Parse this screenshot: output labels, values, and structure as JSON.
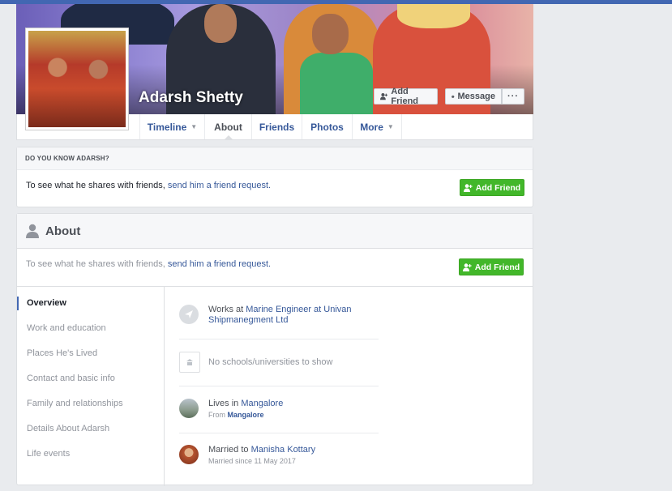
{
  "profile": {
    "name": "Adarsh Shetty"
  },
  "cover_buttons": {
    "add_friend": "Add Friend",
    "message": "Message",
    "more": "···"
  },
  "tabs": [
    {
      "label": "Timeline",
      "dropdown": true
    },
    {
      "label": "About",
      "active": true
    },
    {
      "label": "Friends"
    },
    {
      "label": "Photos"
    },
    {
      "label": "More",
      "dropdown": true
    }
  ],
  "do_you_know": {
    "heading": "DO YOU KNOW ADARSH?",
    "text_before": "To see what he shares with friends,",
    "link": "send him a friend request.",
    "button": "Add Friend"
  },
  "about": {
    "title": "About",
    "note_before": "To see what he shares with friends,",
    "note_link": "send him a friend request.",
    "button": "Add Friend",
    "nav": [
      "Overview",
      "Work and education",
      "Places He's Lived",
      "Contact and basic info",
      "Family and relationships",
      "Details About Adarsh",
      "Life events"
    ],
    "overview": {
      "work": {
        "prefix": "Works at",
        "link": "Marine Engineer at Univan Shipmanegment Ltd"
      },
      "education": {
        "text": "No schools/universities to show"
      },
      "lives": {
        "prefix": "Lives in",
        "link": "Mangalore",
        "sub_prefix": "From",
        "sub_link": "Mangalore"
      },
      "married": {
        "prefix": "Married to",
        "link": "Manisha Kottary",
        "sub": "Married since 11 May 2017"
      }
    }
  },
  "colors": {
    "brand": "#4267b2",
    "link": "#365899",
    "green": "#42b72a",
    "background": "#e9ebee"
  }
}
